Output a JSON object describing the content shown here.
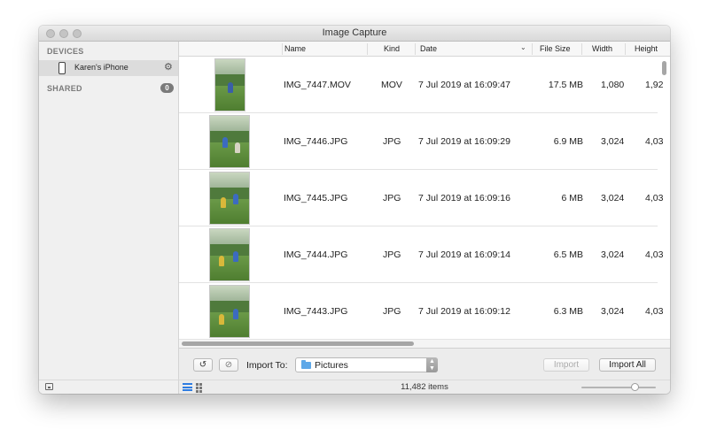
{
  "window": {
    "title": "Image Capture"
  },
  "sidebar": {
    "devices_header": "DEVICES",
    "device": {
      "name": "Karen's iPhone",
      "icon": "iphone-icon",
      "eject_icon": "eject-gear-icon"
    },
    "shared_header": "SHARED",
    "shared_count": "0"
  },
  "table": {
    "columns": {
      "name": "Name",
      "kind": "Kind",
      "date": "Date",
      "file_size": "File Size",
      "width": "Width",
      "height": "Height"
    },
    "rows": [
      {
        "name": "IMG_7447.MOV",
        "kind": "MOV",
        "date": "7 Jul 2019 at 16:09:47",
        "size": "17.5 MB",
        "width": "1,080",
        "height": "1,92"
      },
      {
        "name": "IMG_7446.JPG",
        "kind": "JPG",
        "date": "7 Jul 2019 at 16:09:29",
        "size": "6.9 MB",
        "width": "3,024",
        "height": "4,03"
      },
      {
        "name": "IMG_7445.JPG",
        "kind": "JPG",
        "date": "7 Jul 2019 at 16:09:16",
        "size": "6 MB",
        "width": "3,024",
        "height": "4,03"
      },
      {
        "name": "IMG_7444.JPG",
        "kind": "JPG",
        "date": "7 Jul 2019 at 16:09:14",
        "size": "6.5 MB",
        "width": "3,024",
        "height": "4,03"
      },
      {
        "name": "IMG_7443.JPG",
        "kind": "JPG",
        "date": "7 Jul 2019 at 16:09:12",
        "size": "6.3 MB",
        "width": "3,024",
        "height": "4,03"
      }
    ]
  },
  "toolbar": {
    "rotate_icon": "rotate-left-icon",
    "delete_icon": "delete-icon",
    "import_to_label": "Import To:",
    "import_destination": "Pictures",
    "import_label": "Import",
    "import_all_label": "Import All"
  },
  "status": {
    "item_count": "11,482 items",
    "thumbnail_size_level": 0.75
  },
  "colors": {
    "accent": "#2f7de1",
    "folder": "#5ea8e8"
  }
}
